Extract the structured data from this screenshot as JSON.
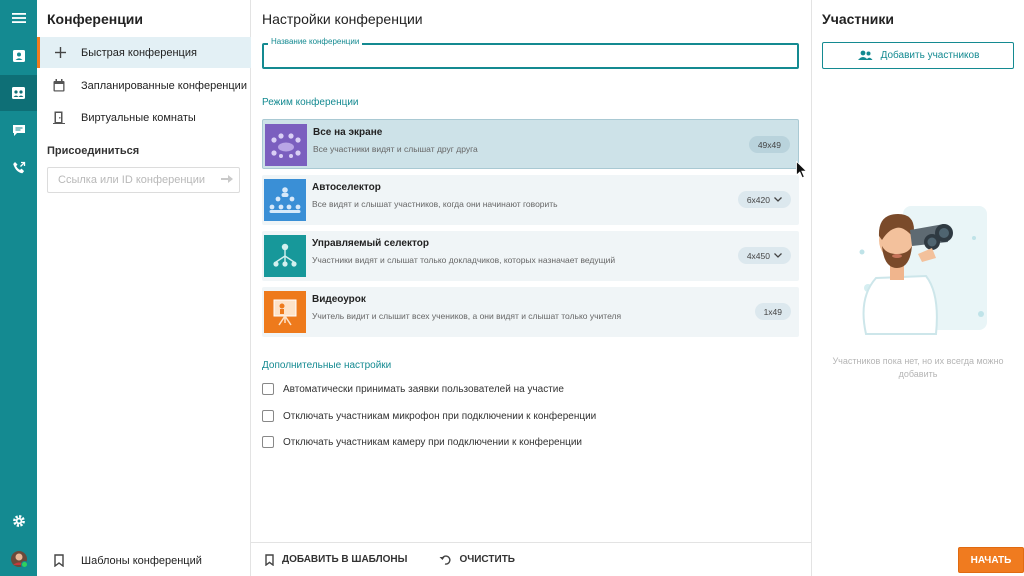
{
  "rail": {
    "icons": [
      "menu-icon",
      "contacts-icon",
      "conference-icon",
      "chat-icon",
      "calls-icon",
      "settings-icon",
      "avatar"
    ]
  },
  "sidebar": {
    "title": "Конференции",
    "items": [
      {
        "label": "Быстрая конференция",
        "icon": "plus-icon"
      },
      {
        "label": "Запланированные конференции",
        "icon": "calendar-icon"
      },
      {
        "label": "Виртуальные комнаты",
        "icon": "door-icon"
      }
    ],
    "join_title": "Присоединиться",
    "join_placeholder": "Ссылка или ID конференции",
    "templates_label": "Шаблоны конференций"
  },
  "settings": {
    "title": "Настройки конференции",
    "name_label": "Название конференции",
    "name_value": "",
    "mode_title": "Режим конференции",
    "modes": [
      {
        "title": "Все на экране",
        "desc": "Все участники видят и слышат друг друга",
        "badge": "49x49",
        "color": "#7b5fbf",
        "dropdown": false,
        "selected": true
      },
      {
        "title": "Автоселектор",
        "desc": "Все видят и слышат участников, когда они начинают говорить",
        "badge": "6x420",
        "color": "#3a8fd6",
        "dropdown": true,
        "selected": false
      },
      {
        "title": "Управляемый селектор",
        "desc": "Участники видят и слышат только докладчиков, которых назначает ведущий",
        "badge": "4x450",
        "color": "#17989a",
        "dropdown": true,
        "selected": false
      },
      {
        "title": "Видеоурок",
        "desc": "Учитель видит и слышит всех учеников, а они видят и слышат только учителя",
        "badge": "1x49",
        "color": "#ee7a1c",
        "dropdown": false,
        "selected": false
      }
    ],
    "extra_title": "Дополнительные настройки",
    "checkboxes": [
      "Автоматически принимать заявки пользователей на участие",
      "Отключать участникам микрофон при подключении к конференции",
      "Отключать участникам камеру при подключении к конференции"
    ],
    "add_template_label": "ДОБАВИТЬ В ШАБЛОНЫ",
    "clear_label": "ОЧИСТИТЬ"
  },
  "participants": {
    "title": "Участники",
    "add_label": "Добавить участников",
    "empty_text": "Участников пока нет, но их всегда можно добавить",
    "start_label": "НАЧАТЬ"
  },
  "colors": {
    "accent": "#148a91",
    "orange": "#f07b1f"
  }
}
